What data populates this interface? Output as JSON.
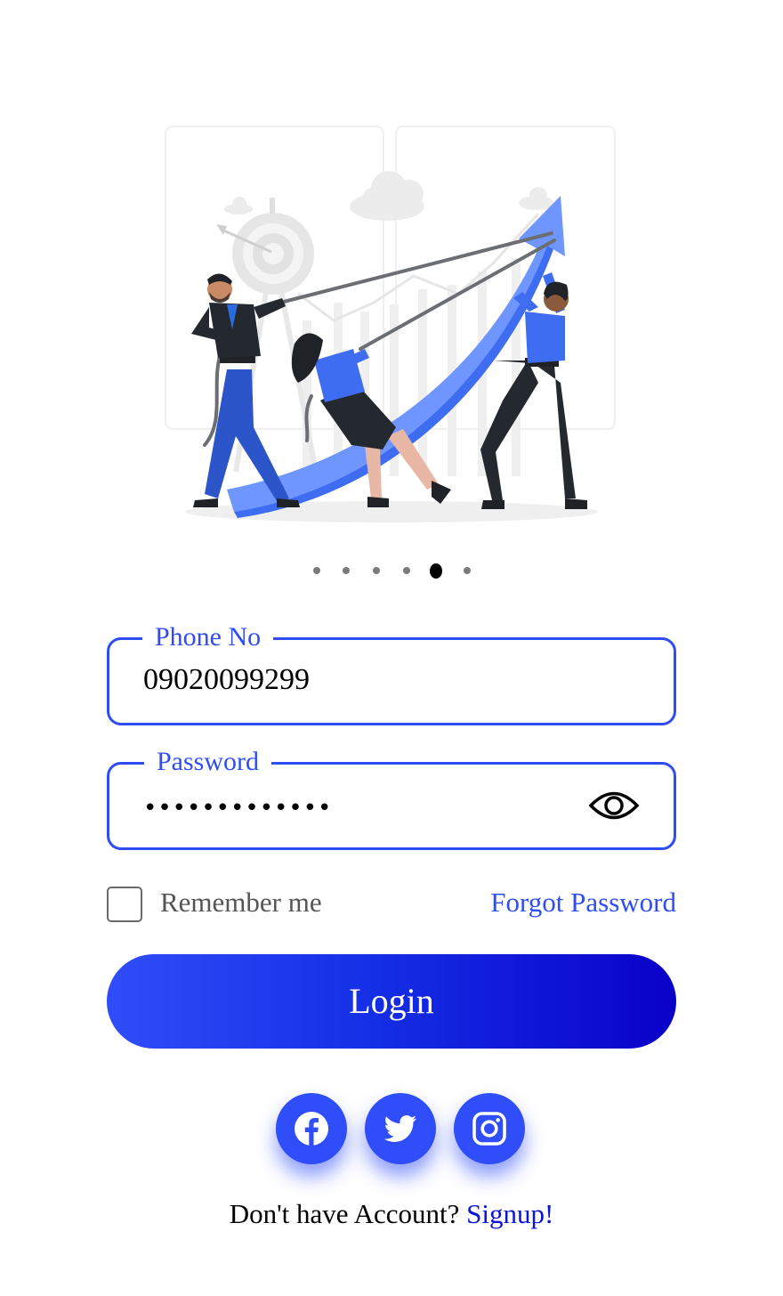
{
  "carousel": {
    "slide_count": 6,
    "active_index": 4
  },
  "form": {
    "phone": {
      "label": "Phone No",
      "value": "09020099299"
    },
    "password": {
      "label": "Password",
      "masked_value": "•••••••••••••",
      "toggle_icon": "eye-icon"
    },
    "remember_label": "Remember me",
    "remember_checked": false,
    "forgot_label": "Forgot Password",
    "login_label": "Login"
  },
  "social": [
    {
      "name": "facebook",
      "icon": "facebook-icon"
    },
    {
      "name": "twitter",
      "icon": "twitter-icon"
    },
    {
      "name": "instagram",
      "icon": "instagram-icon"
    }
  ],
  "footer": {
    "prompt": "Don't have Account?",
    "signup_label": "Signup!"
  },
  "colors": {
    "accent": "#2f4df5",
    "gradient_start": "#2f4df8",
    "gradient_end": "#0a00c8",
    "link": "#0a14d8"
  }
}
